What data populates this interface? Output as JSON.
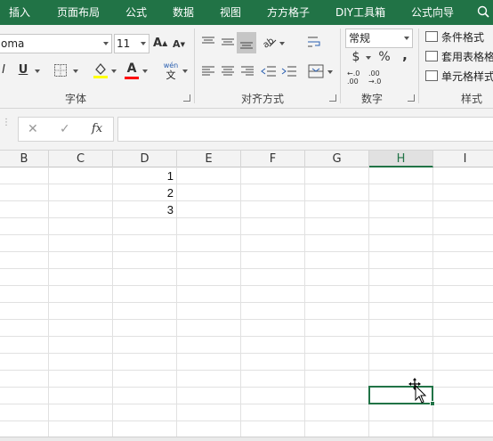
{
  "ribbon_tabs": [
    "插入",
    "页面布局",
    "公式",
    "数据",
    "视图",
    "方方格子",
    "DIY工具箱",
    "公式向导"
  ],
  "font": {
    "name": "oma",
    "size": "11",
    "bold": "I",
    "underline": "U",
    "phonetic_top": "wén",
    "phonetic_bottom": "文",
    "group_label": "字体"
  },
  "alignment": {
    "group_label": "对齐方式"
  },
  "number": {
    "format": "常规",
    "currency": "$",
    "percent": "%",
    "comma": ",",
    "dec_inc": "←.0\n.00",
    "dec_dec": ".00\n→.0",
    "group_label": "数字"
  },
  "styles": {
    "conditional": "条件格式",
    "table": "套用表格格",
    "cell": "单元格样式",
    "group_label": "样式"
  },
  "formula_bar": {
    "cancel": "✕",
    "enter": "✓",
    "fx": "fx",
    "value": ""
  },
  "columns": [
    "B",
    "C",
    "D",
    "E",
    "F",
    "G",
    "H",
    "I"
  ],
  "selected_column": "H",
  "cells": [
    {
      "col": "D",
      "row": 1,
      "value": "1"
    },
    {
      "col": "D",
      "row": 2,
      "value": "2"
    },
    {
      "col": "D",
      "row": 3,
      "value": "3"
    }
  ],
  "icons": [
    "search-icon",
    "increase-font-icon",
    "decrease-font-icon",
    "border-icon",
    "fill-color-icon",
    "font-color-icon",
    "align-top-icon",
    "align-middle-icon",
    "align-bottom-icon",
    "orientation-icon",
    "wrap-text-icon",
    "align-left-icon",
    "align-center-icon",
    "align-right-icon",
    "indent-decrease-icon",
    "indent-increase-icon",
    "merge-icon",
    "cursor-move-icon"
  ],
  "colors": {
    "accent": "#217346",
    "fill_color": "#ffff00",
    "font_color": "#ff0000"
  }
}
